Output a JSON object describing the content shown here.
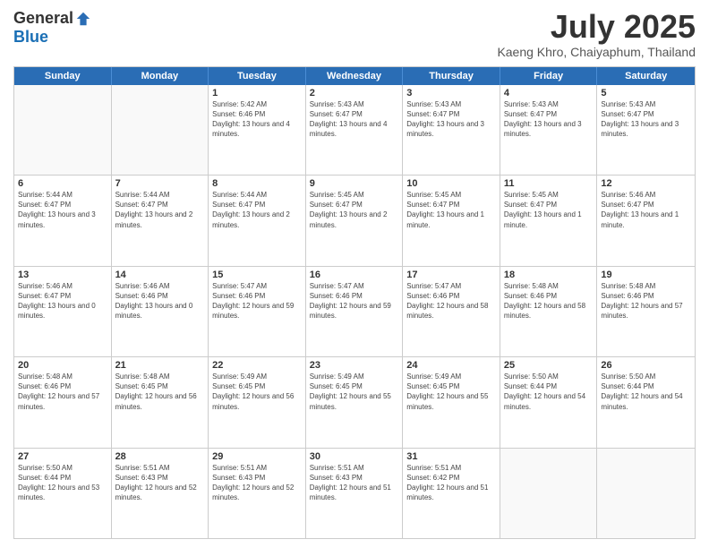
{
  "header": {
    "logo_general": "General",
    "logo_blue": "Blue",
    "month_title": "July 2025",
    "location": "Kaeng Khro, Chaiyaphum, Thailand"
  },
  "weekdays": [
    "Sunday",
    "Monday",
    "Tuesday",
    "Wednesday",
    "Thursday",
    "Friday",
    "Saturday"
  ],
  "rows": [
    [
      {
        "day": "",
        "info": ""
      },
      {
        "day": "",
        "info": ""
      },
      {
        "day": "1",
        "info": "Sunrise: 5:42 AM\nSunset: 6:46 PM\nDaylight: 13 hours and 4 minutes."
      },
      {
        "day": "2",
        "info": "Sunrise: 5:43 AM\nSunset: 6:47 PM\nDaylight: 13 hours and 4 minutes."
      },
      {
        "day": "3",
        "info": "Sunrise: 5:43 AM\nSunset: 6:47 PM\nDaylight: 13 hours and 3 minutes."
      },
      {
        "day": "4",
        "info": "Sunrise: 5:43 AM\nSunset: 6:47 PM\nDaylight: 13 hours and 3 minutes."
      },
      {
        "day": "5",
        "info": "Sunrise: 5:43 AM\nSunset: 6:47 PM\nDaylight: 13 hours and 3 minutes."
      }
    ],
    [
      {
        "day": "6",
        "info": "Sunrise: 5:44 AM\nSunset: 6:47 PM\nDaylight: 13 hours and 3 minutes."
      },
      {
        "day": "7",
        "info": "Sunrise: 5:44 AM\nSunset: 6:47 PM\nDaylight: 13 hours and 2 minutes."
      },
      {
        "day": "8",
        "info": "Sunrise: 5:44 AM\nSunset: 6:47 PM\nDaylight: 13 hours and 2 minutes."
      },
      {
        "day": "9",
        "info": "Sunrise: 5:45 AM\nSunset: 6:47 PM\nDaylight: 13 hours and 2 minutes."
      },
      {
        "day": "10",
        "info": "Sunrise: 5:45 AM\nSunset: 6:47 PM\nDaylight: 13 hours and 1 minute."
      },
      {
        "day": "11",
        "info": "Sunrise: 5:45 AM\nSunset: 6:47 PM\nDaylight: 13 hours and 1 minute."
      },
      {
        "day": "12",
        "info": "Sunrise: 5:46 AM\nSunset: 6:47 PM\nDaylight: 13 hours and 1 minute."
      }
    ],
    [
      {
        "day": "13",
        "info": "Sunrise: 5:46 AM\nSunset: 6:47 PM\nDaylight: 13 hours and 0 minutes."
      },
      {
        "day": "14",
        "info": "Sunrise: 5:46 AM\nSunset: 6:46 PM\nDaylight: 13 hours and 0 minutes."
      },
      {
        "day": "15",
        "info": "Sunrise: 5:47 AM\nSunset: 6:46 PM\nDaylight: 12 hours and 59 minutes."
      },
      {
        "day": "16",
        "info": "Sunrise: 5:47 AM\nSunset: 6:46 PM\nDaylight: 12 hours and 59 minutes."
      },
      {
        "day": "17",
        "info": "Sunrise: 5:47 AM\nSunset: 6:46 PM\nDaylight: 12 hours and 58 minutes."
      },
      {
        "day": "18",
        "info": "Sunrise: 5:48 AM\nSunset: 6:46 PM\nDaylight: 12 hours and 58 minutes."
      },
      {
        "day": "19",
        "info": "Sunrise: 5:48 AM\nSunset: 6:46 PM\nDaylight: 12 hours and 57 minutes."
      }
    ],
    [
      {
        "day": "20",
        "info": "Sunrise: 5:48 AM\nSunset: 6:46 PM\nDaylight: 12 hours and 57 minutes."
      },
      {
        "day": "21",
        "info": "Sunrise: 5:48 AM\nSunset: 6:45 PM\nDaylight: 12 hours and 56 minutes."
      },
      {
        "day": "22",
        "info": "Sunrise: 5:49 AM\nSunset: 6:45 PM\nDaylight: 12 hours and 56 minutes."
      },
      {
        "day": "23",
        "info": "Sunrise: 5:49 AM\nSunset: 6:45 PM\nDaylight: 12 hours and 55 minutes."
      },
      {
        "day": "24",
        "info": "Sunrise: 5:49 AM\nSunset: 6:45 PM\nDaylight: 12 hours and 55 minutes."
      },
      {
        "day": "25",
        "info": "Sunrise: 5:50 AM\nSunset: 6:44 PM\nDaylight: 12 hours and 54 minutes."
      },
      {
        "day": "26",
        "info": "Sunrise: 5:50 AM\nSunset: 6:44 PM\nDaylight: 12 hours and 54 minutes."
      }
    ],
    [
      {
        "day": "27",
        "info": "Sunrise: 5:50 AM\nSunset: 6:44 PM\nDaylight: 12 hours and 53 minutes."
      },
      {
        "day": "28",
        "info": "Sunrise: 5:51 AM\nSunset: 6:43 PM\nDaylight: 12 hours and 52 minutes."
      },
      {
        "day": "29",
        "info": "Sunrise: 5:51 AM\nSunset: 6:43 PM\nDaylight: 12 hours and 52 minutes."
      },
      {
        "day": "30",
        "info": "Sunrise: 5:51 AM\nSunset: 6:43 PM\nDaylight: 12 hours and 51 minutes."
      },
      {
        "day": "31",
        "info": "Sunrise: 5:51 AM\nSunset: 6:42 PM\nDaylight: 12 hours and 51 minutes."
      },
      {
        "day": "",
        "info": ""
      },
      {
        "day": "",
        "info": ""
      }
    ]
  ]
}
